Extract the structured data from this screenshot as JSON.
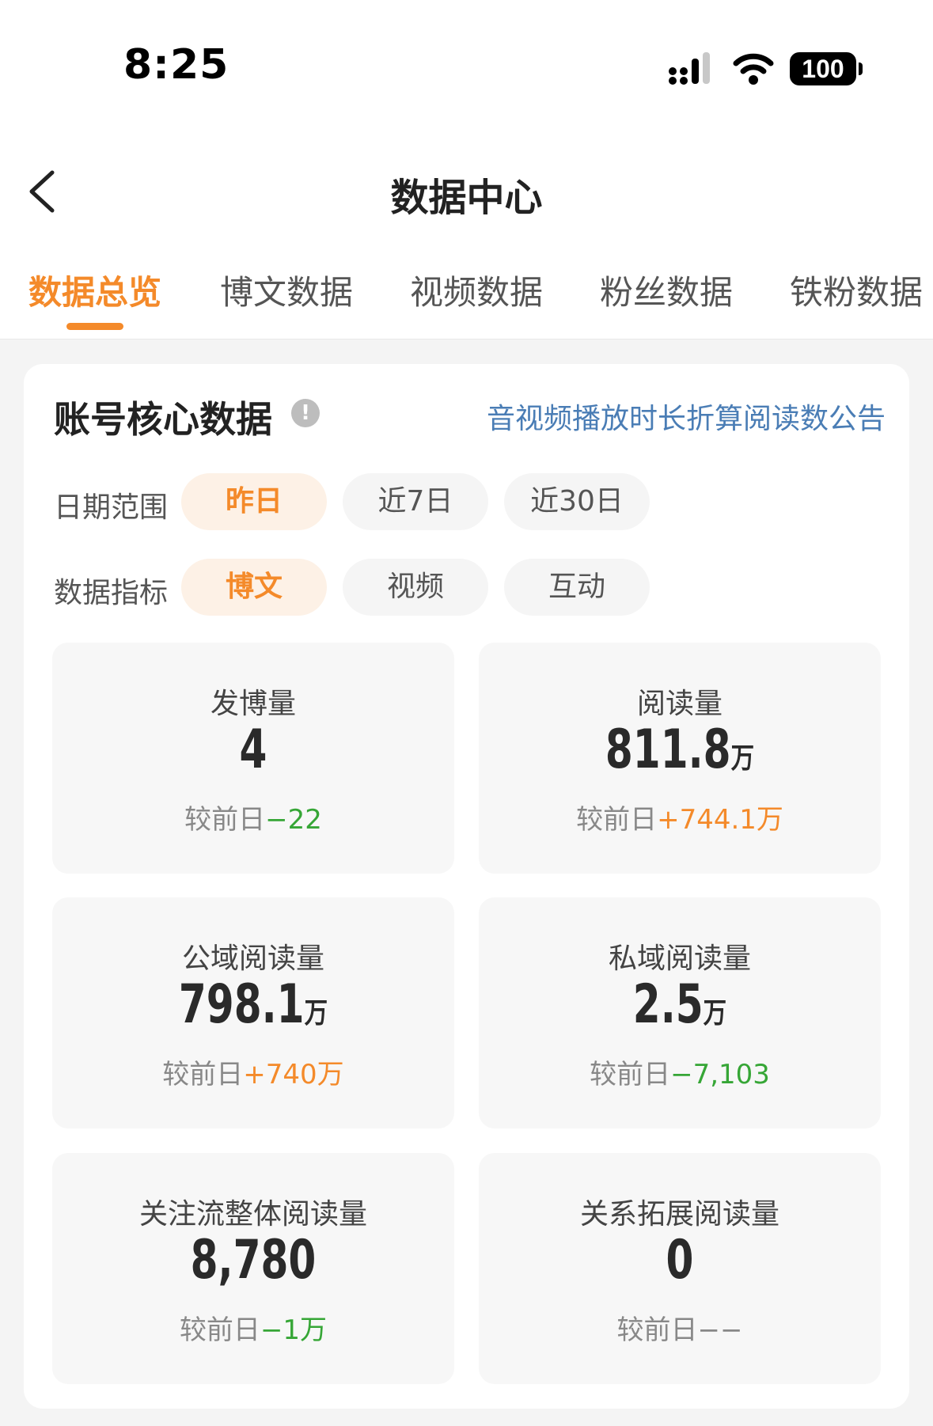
{
  "status_bar": {
    "time": "8:25",
    "battery": "100"
  },
  "nav": {
    "title": "数据中心"
  },
  "tabs": [
    {
      "label": "数据总览",
      "active": true
    },
    {
      "label": "博文数据"
    },
    {
      "label": "视频数据"
    },
    {
      "label": "粉丝数据"
    },
    {
      "label": "铁粉数据"
    }
  ],
  "card": {
    "title": "账号核心数据",
    "info_icon": "!",
    "notice_link": "音视频播放时长折算阅读数公告"
  },
  "date_range": {
    "label": "日期范围",
    "options": [
      "昨日",
      "近7日",
      "近30日"
    ],
    "selected": "昨日"
  },
  "metric_type": {
    "label": "数据指标",
    "options": [
      "博文",
      "视频",
      "互动"
    ],
    "selected": "博文"
  },
  "metrics": [
    {
      "label": "发博量",
      "value": "4",
      "unit": "",
      "delta_prefix": "较前日",
      "delta": "−22"
    },
    {
      "label": "阅读量",
      "value": "811.8",
      "unit": "万",
      "delta_prefix": "较前日",
      "delta": "+744.1万"
    },
    {
      "label": "公域阅读量",
      "value": "798.1",
      "unit": "万",
      "delta_prefix": "较前日",
      "delta": "+740万"
    },
    {
      "label": "私域阅读量",
      "value": "2.5",
      "unit": "万",
      "delta_prefix": "较前日",
      "delta": "−7,103"
    },
    {
      "label": "关注流整体阅读量",
      "value": "8,780",
      "unit": "",
      "delta_prefix": "较前日",
      "delta": "−1万"
    },
    {
      "label": "关系拓展阅读量",
      "value": "0",
      "unit": "",
      "delta_prefix": "较前日",
      "delta": "−−"
    }
  ],
  "colors": {
    "accent": "#f48a2a",
    "decrease": "#36a636",
    "link": "#4a7db5"
  }
}
